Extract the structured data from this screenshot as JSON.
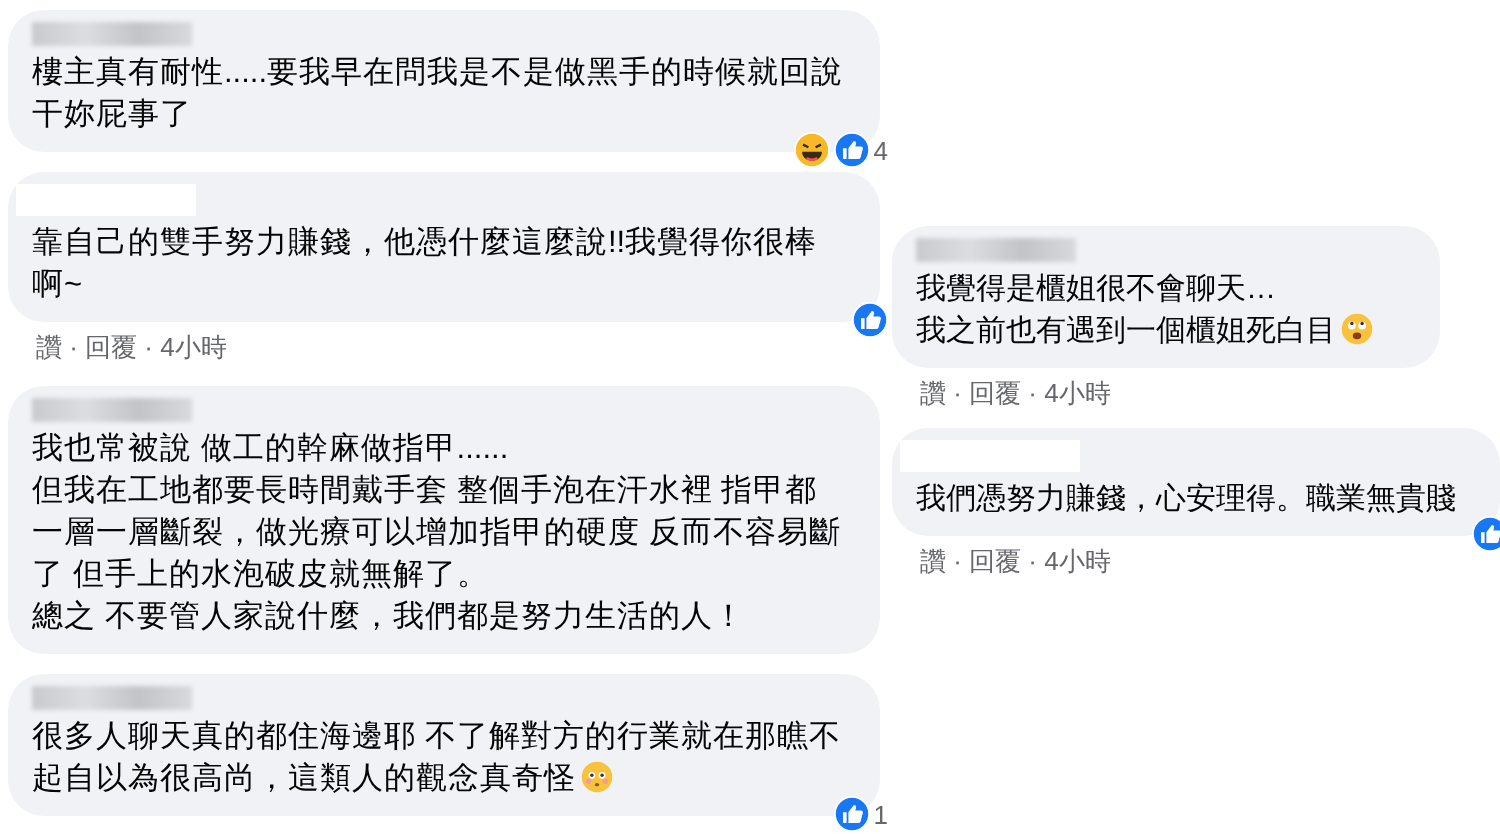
{
  "columns": [
    {
      "comments": [
        {
          "name_blurred": true,
          "lines": [
            "樓主真有耐性.....要我早在問我是不是做黑手的時候就回說",
            "干妳屁事了"
          ],
          "reactions": [
            {
              "kind": "haha"
            },
            {
              "kind": "like"
            }
          ],
          "reaction_count": "4"
        },
        {
          "name_blurred": false,
          "lines": [
            "靠自己的雙手努力賺錢，他憑什麼這麼說!!我覺得你很棒",
            "啊~"
          ],
          "reactions": [
            {
              "kind": "like"
            }
          ],
          "meta": "讚 · 回覆 · 4小時"
        },
        {
          "name_blurred": true,
          "lines": [
            "我也常被說 做工的幹麻做指甲......",
            "但我在工地都要長時間戴手套 整個手泡在汗水裡 指甲都",
            "一層一層斷裂，做光療可以增加指甲的硬度 反而不容易斷",
            "了 但手上的水泡破皮就無解了。",
            "總之 不要管人家說什麼，我們都是努力生活的人！"
          ]
        },
        {
          "name_blurred": true,
          "lines": [
            "很多人聊天真的都住海邊耶 不了解對方的行業就在那瞧不",
            "起自以為很高尚，這類人的觀念真奇怪"
          ],
          "emoji": {
            "kind": "flushed"
          },
          "reactions": [
            {
              "kind": "like"
            }
          ],
          "reaction_count": "1"
        }
      ]
    },
    {
      "comments": [
        {
          "name_blurred": true,
          "lines": [
            "我覺得是櫃姐很不會聊天…",
            "我之前也有遇到一個櫃姐死白目"
          ],
          "emoji": {
            "kind": "dizzy"
          },
          "meta": "讚 · 回覆 · 4小時"
        },
        {
          "name_blurred": false,
          "lines": [
            "我們憑努力賺錢，心安理得。職業無貴賤"
          ],
          "reactions": [
            {
              "kind": "like"
            }
          ],
          "meta": "讚 · 回覆 · 4小時"
        }
      ]
    }
  ]
}
